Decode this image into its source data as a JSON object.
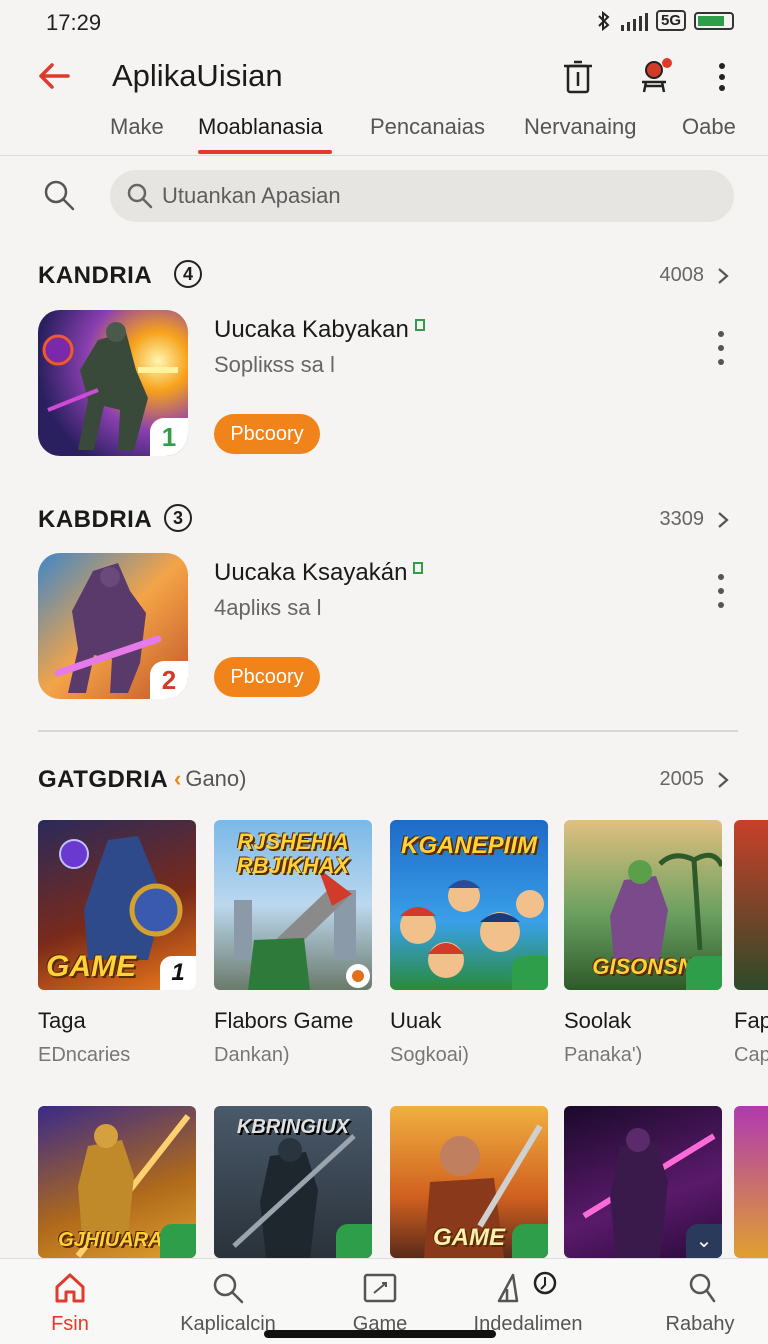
{
  "status_bar": {
    "time": "17:29",
    "network": "5G"
  },
  "header": {
    "title": "AplikaUisian"
  },
  "tabs": [
    {
      "label": "Make",
      "active": false
    },
    {
      "label": "Moablanasia",
      "active": true
    },
    {
      "label": "Pencanaias",
      "active": false
    },
    {
      "label": "Nervanaing",
      "active": false
    },
    {
      "label": "Oabe",
      "active": false
    }
  ],
  "search": {
    "placeholder": "Utuankan Apasian"
  },
  "sections": [
    {
      "title": "KANDRIA",
      "badge": "4",
      "count": "4008",
      "app": {
        "name": "Uucaka Kabyakan",
        "subtitle": "Sopliкss sa l",
        "button": "Pbcoory",
        "rank": "1",
        "rank_color": "#2e9e4b"
      }
    },
    {
      "title": "KABDRIA",
      "badge": "3",
      "count": "3309",
      "app": {
        "name": "Uucaka Ksayakán",
        "subtitle": "4apliкs sa l",
        "button": "Pbcoory",
        "rank": "2",
        "rank_color": "#d23a2a"
      }
    }
  ],
  "games_section": {
    "title": "GATGDRIA",
    "subtitle": "Gano)",
    "count": "2005",
    "cards": [
      {
        "name": "Taga",
        "subtitle": "EDncaries",
        "image_text": "GAME",
        "chip": "1"
      },
      {
        "name": "Flabors Game",
        "subtitle": "Dankan)",
        "image_text": "RJSHEHIA RBJIKHAX",
        "chip": ""
      },
      {
        "name": "Uuak",
        "subtitle": "Sogkoai)",
        "image_text": "KGANEPIIM",
        "chip": ""
      },
      {
        "name": "Soolak",
        "subtitle": "Panaka')",
        "image_text": "GISONSN",
        "chip": ""
      },
      {
        "name": "Fap",
        "subtitle": "Cap",
        "image_text": "",
        "chip": ""
      }
    ],
    "row2_cards": [
      {
        "image_text": "GJHIUARAX"
      },
      {
        "image_text": "KBRINGIUX"
      },
      {
        "image_text": "GAME"
      },
      {
        "image_text": ""
      },
      {
        "image_text": ""
      }
    ]
  },
  "bottom_nav": [
    {
      "label": "Fsin",
      "icon": "home-icon",
      "active": true
    },
    {
      "label": "Kaplicalcin",
      "icon": "search-icon",
      "active": false
    },
    {
      "label": "Game",
      "icon": "game-icon",
      "active": false
    },
    {
      "label": "Indedalimen",
      "icon": "charts-icon",
      "active": false
    },
    {
      "label": "Rabahy",
      "icon": "profile-icon",
      "active": false
    }
  ],
  "colors": {
    "accent": "#e03a2c",
    "button": "#f0841a",
    "verified": "#2e9e4b"
  }
}
